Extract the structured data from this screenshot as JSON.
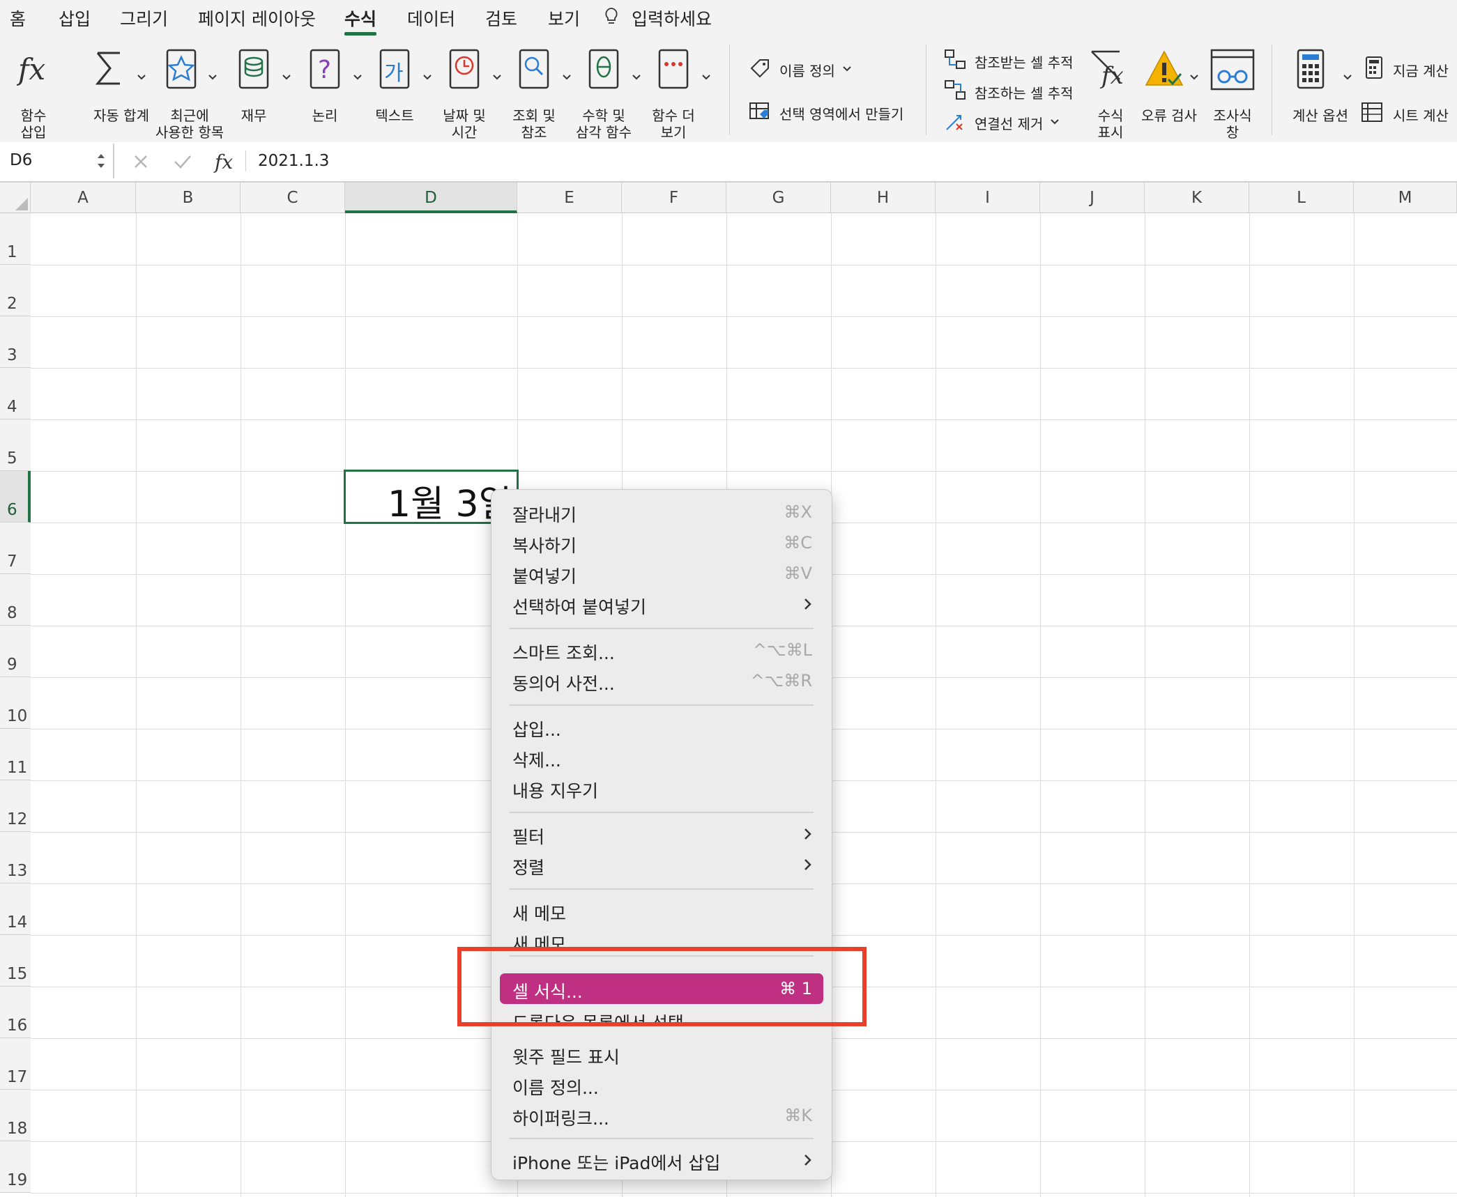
{
  "tabs": [
    "홈",
    "삽입",
    "그리기",
    "페이지 레이아웃",
    "수식",
    "데이터",
    "검토",
    "보기"
  ],
  "active_tab": "수식",
  "tell_me": "입력하세요",
  "ribbon": {
    "insert_function": [
      "함수",
      "삽입"
    ],
    "autosum": "자동 합계",
    "recent": [
      "최근에",
      "사용한 항목"
    ],
    "financial": "재무",
    "logical": "논리",
    "text": "텍스트",
    "datetime": [
      "날짜 및",
      "시간"
    ],
    "lookup": [
      "조회 및",
      "참조"
    ],
    "math": [
      "수학 및",
      "삼각 함수"
    ],
    "more": [
      "함수 더",
      "보기"
    ],
    "define_name": "이름 정의",
    "create_from_selection": "선택 영역에서 만들기",
    "trace_precedents": "참조받는 셀 추적",
    "trace_dependents": "참조하는 셀 추적",
    "remove_arrows": "연결선 제거",
    "show_formulas": [
      "수식",
      "표시"
    ],
    "error_check": "오류 검사",
    "watch": [
      "조사식",
      "창"
    ],
    "calc_options": "계산 옵션",
    "calc_now": "지금 계산",
    "calc_sheet": "시트 계산",
    "text_icon_glyph": "가"
  },
  "formula_bar": {
    "name_box": "D6",
    "content": "2021.1.3"
  },
  "columns": [
    "A",
    "B",
    "C",
    "D",
    "E",
    "F",
    "G",
    "H",
    "I",
    "J",
    "K",
    "L",
    "M"
  ],
  "rows": [
    "1",
    "2",
    "3",
    "4",
    "5",
    "6",
    "7",
    "8",
    "9",
    "10",
    "11",
    "12",
    "13",
    "14",
    "15",
    "16",
    "17",
    "18",
    "19"
  ],
  "active_cell_value": "1월 3일",
  "context_menu": {
    "items": [
      {
        "label": "잘라내기",
        "shortcut": "⌘X"
      },
      {
        "label": "복사하기",
        "shortcut": "⌘C"
      },
      {
        "label": "붙여넣기",
        "shortcut": "⌘V"
      },
      {
        "label": "선택하여 붙여넣기",
        "submenu": true
      },
      {
        "label": "스마트 조회...",
        "shortcut": "^⌥⌘L"
      },
      {
        "label": "동의어 사전...",
        "shortcut": "^⌥⌘R"
      },
      {
        "label": "삽입..."
      },
      {
        "label": "삭제..."
      },
      {
        "label": "내용 지우기"
      },
      {
        "label": "필터",
        "submenu": true
      },
      {
        "label": "정렬",
        "submenu": true
      },
      {
        "label": "새 메모"
      },
      {
        "label": "새 메모"
      },
      {
        "label": "셀 서식...",
        "shortcut": "⌘ 1",
        "highlighted": true
      },
      {
        "label": "드롭다운 목록에서 선택"
      },
      {
        "label": "윗주 필드 표시"
      },
      {
        "label": "이름 정의..."
      },
      {
        "label": "하이퍼링크...",
        "shortcut": "⌘K"
      },
      {
        "label": "iPhone 또는 iPad에서 삽입",
        "submenu": true
      }
    ]
  },
  "colors": {
    "accent": "#217346",
    "highlight": "#bf2f82",
    "annotation": "#e8402a"
  }
}
